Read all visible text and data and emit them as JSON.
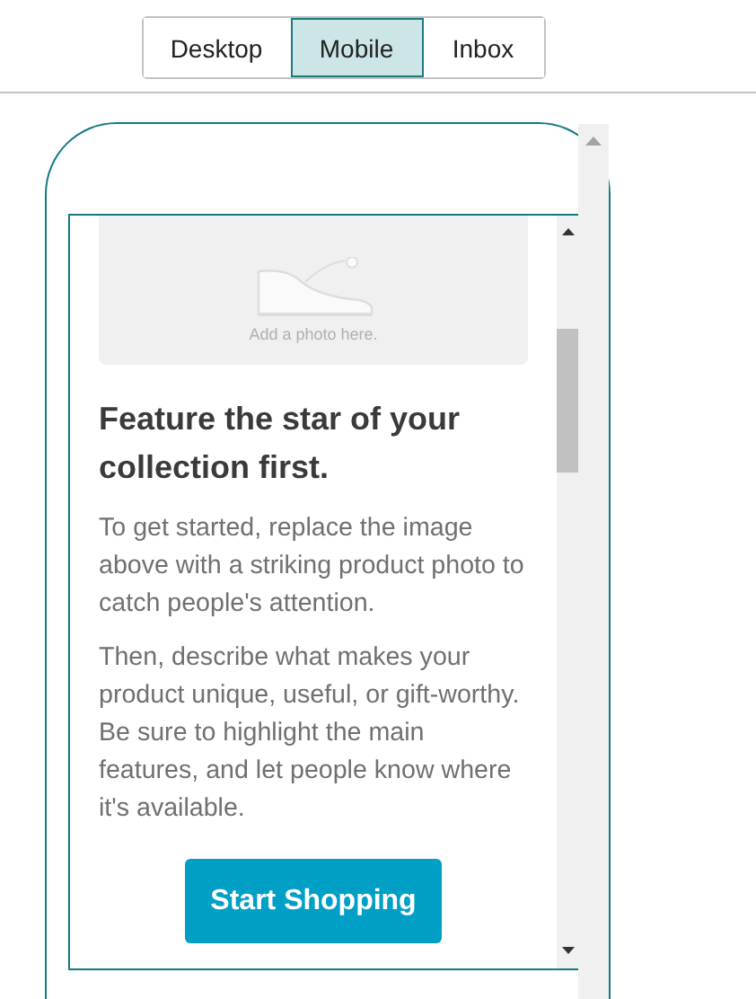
{
  "tabs": [
    {
      "label": "Desktop",
      "selected": false
    },
    {
      "label": "Mobile",
      "selected": true
    },
    {
      "label": "Inbox",
      "selected": false
    }
  ],
  "preview": {
    "photo_hint": "Add a photo here.",
    "heading": "Feature the star of your collection first.",
    "paragraphs": [
      "To get started, replace the image above with a striking product photo to catch people's attention.",
      "Then, describe what makes your product unique, useful, or gift-worthy. Be sure to highlight the main features, and let people know where it's available."
    ],
    "button": "Start Shopping"
  }
}
